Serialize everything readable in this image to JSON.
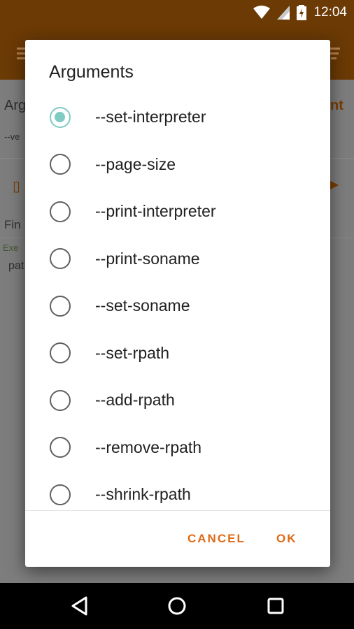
{
  "status_bar": {
    "time": "12:04",
    "icons": [
      "wifi-icon",
      "signal-icon",
      "battery-charging-icon"
    ]
  },
  "background": {
    "label_1": "Arg",
    "label_2": "--ve",
    "label_3": "Fin",
    "label_4": "Exe",
    "label_5": "pat",
    "accent_text": "nt"
  },
  "dialog": {
    "title": "Arguments",
    "options": [
      {
        "label": "--set-interpreter",
        "checked": true
      },
      {
        "label": "--page-size",
        "checked": false
      },
      {
        "label": "--print-interpreter",
        "checked": false
      },
      {
        "label": "--print-soname",
        "checked": false
      },
      {
        "label": "--set-soname",
        "checked": false
      },
      {
        "label": "--set-rpath",
        "checked": false
      },
      {
        "label": "--add-rpath",
        "checked": false
      },
      {
        "label": "--remove-rpath",
        "checked": false
      },
      {
        "label": "--shrink-rpath",
        "checked": false
      }
    ],
    "cancel_label": "CANCEL",
    "ok_label": "OK"
  },
  "colors": {
    "accent": "#e06a17",
    "radio_checked": "#80cbc4",
    "app_bar": "#6b3a05"
  },
  "nav_bar": {
    "icons": [
      "back-icon",
      "home-icon",
      "recents-icon"
    ]
  }
}
